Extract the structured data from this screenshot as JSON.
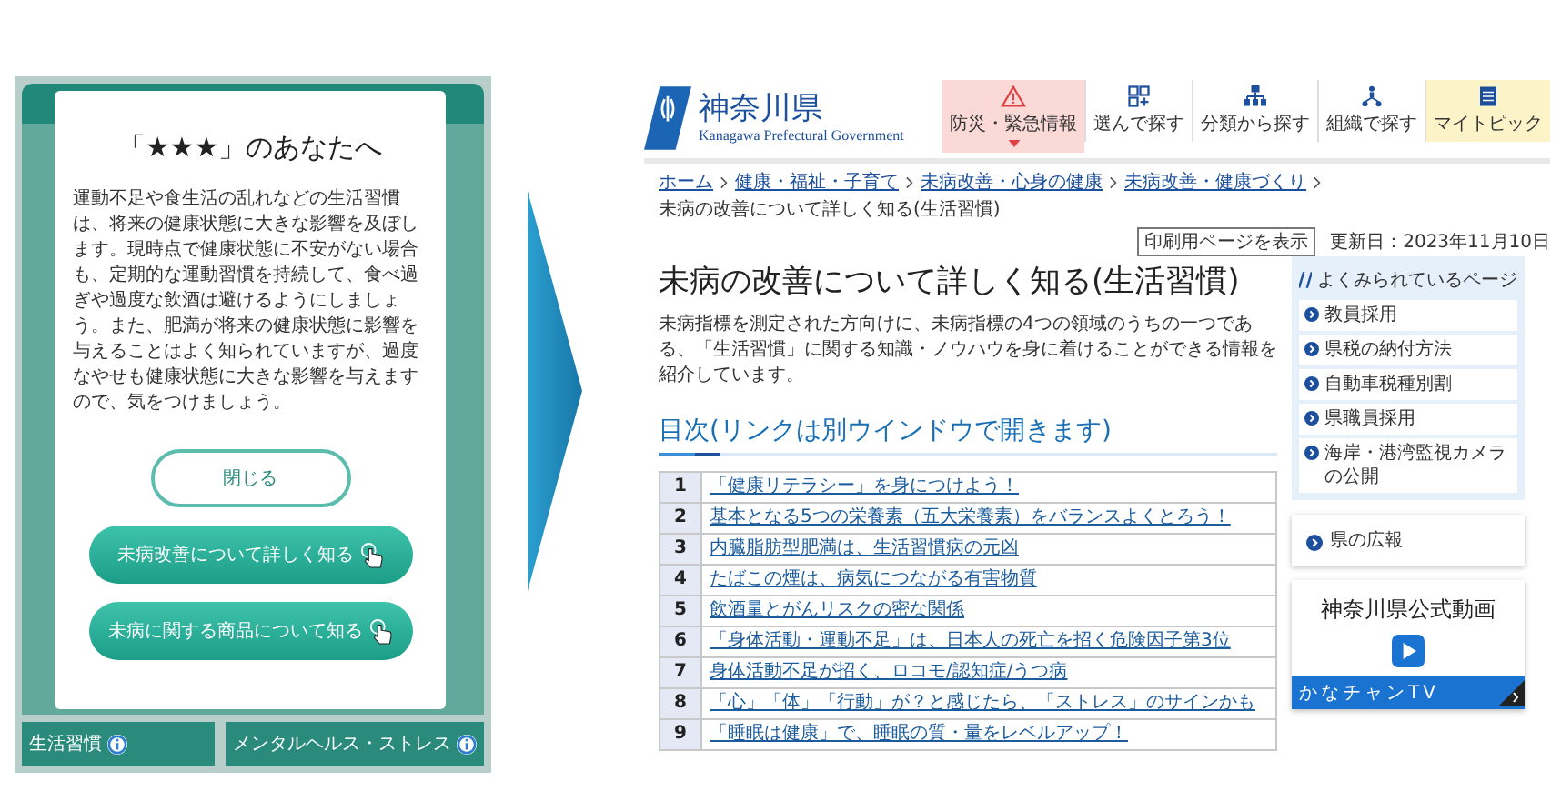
{
  "left_screen": {
    "modal": {
      "title": "「★★★」のあなたへ",
      "body": "運動不足や食生活の乱れなどの生活習慣は、将来の健康状態に大きな影響を及ぼします。現時点で健康状態に不安がない場合も、定期的な運動習慣を持続して、食べ過ぎや過度な飲酒は避けるようにしましょう。また、肥満が将来の健康状態に影響を与えることはよく知られていますが、過度なやせも健康状態に大きな影響を与えますので、気をつけましょう。",
      "buttons": [
        {
          "label": "閉じる",
          "kind": "outline"
        },
        {
          "label": "未病改善について詳しく知る",
          "kind": "filled"
        },
        {
          "label": "未病に関する商品について知る",
          "kind": "filled"
        }
      ]
    },
    "tiles": [
      {
        "label": "生活習慣"
      },
      {
        "label": "メンタルヘルス・ストレス"
      }
    ]
  },
  "web_page": {
    "header": {
      "site_name": "神奈川県",
      "site_name_en": "Kanagawa Prefectural Government",
      "nav": [
        {
          "label": "防災・緊急情報",
          "kind": "emergency"
        },
        {
          "label": "選んで探す",
          "kind": "select"
        },
        {
          "label": "分類から探す",
          "kind": "category"
        },
        {
          "label": "組織で探す",
          "kind": "organization"
        },
        {
          "label": "マイトピック",
          "kind": "mytopic"
        }
      ]
    },
    "breadcrumb": [
      {
        "label": "ホーム",
        "link": true
      },
      {
        "label": "健康・福祉・子育て",
        "link": true
      },
      {
        "label": "未病改善・心身の健康",
        "link": true
      },
      {
        "label": "未病改善・健康づくり",
        "link": true
      },
      {
        "label": "未病の改善について詳しく知る(生活習慣)",
        "link": false
      }
    ],
    "print_button": "印刷用ページを表示",
    "updated": "更新日：2023年11月10日",
    "title": "未病の改善について詳しく知る(生活習慣)",
    "description": "未病指標を測定された方向けに、未病指標の4つの領域のうちの一つである、「生活習慣」に関する知識・ノウハウを身に着けることができる情報を紹介しています。",
    "toc": {
      "heading": "目次(リンクは別ウインドウで開きます)",
      "rows": [
        {
          "number": "1",
          "label": "「健康リテラシー」を身につけよう！"
        },
        {
          "number": "2",
          "label": "基本となる5つの栄養素（五大栄養素）をバランスよくとろう！"
        },
        {
          "number": "3",
          "label": "内臓脂肪型肥満は、生活習慣病の元凶"
        },
        {
          "number": "4",
          "label": "たばこの煙は、病気につながる有害物質"
        },
        {
          "number": "5",
          "label": "飲酒量とがんリスクの密な関係"
        },
        {
          "number": "6",
          "label": "「身体活動・運動不足」は、日本人の死亡を招く危険因子第3位"
        },
        {
          "number": "7",
          "label": "身体活動不足が招く、ロコモ/認知症/うつ病"
        },
        {
          "number": "8",
          "label": "「心」「体」「行動」が？と感じたら、「ストレス」のサインかも"
        },
        {
          "number": "9",
          "label": "「睡眠は健康」で、睡眠の質・量をレベルアップ！"
        }
      ]
    },
    "sidebar": {
      "popular": {
        "heading": "よくみられているページ",
        "items": [
          "教員採用",
          "県税の納付方法",
          "自動車税種別割",
          "県職員採用",
          "海岸・港湾監視カメラの公開"
        ]
      },
      "pr_link": "県の広報",
      "video": {
        "title": "神奈川県公式動画",
        "banner": "かなチャンTV"
      }
    }
  }
}
